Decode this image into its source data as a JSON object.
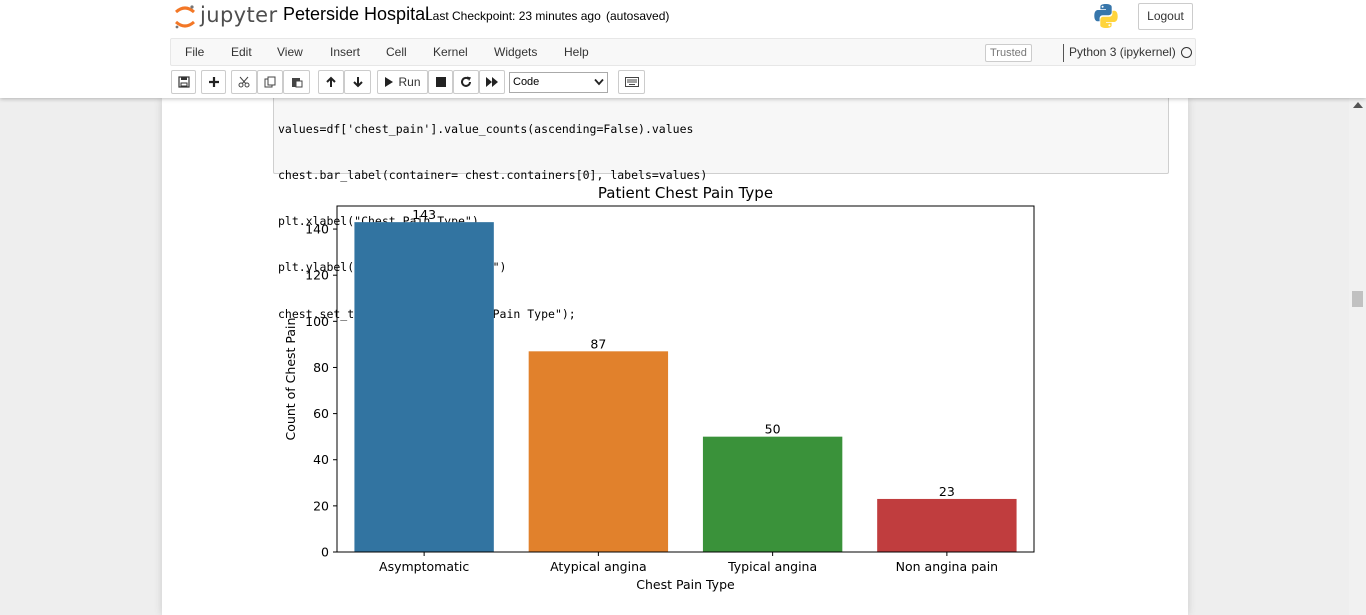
{
  "header": {
    "logo_text": "jupyter",
    "notebook_title": "Peterside Hospital",
    "checkpoint": "Last Checkpoint: 23 minutes ago",
    "autosave_status": "(autosaved)",
    "logout_label": "Logout"
  },
  "menu": {
    "items": [
      "File",
      "Edit",
      "View",
      "Insert",
      "Cell",
      "Kernel",
      "Widgets",
      "Help"
    ],
    "trusted_label": "Trusted",
    "kernel_name": "Python 3 (ipykernel)"
  },
  "toolbar": {
    "run_label": "Run",
    "cell_type": "Code"
  },
  "code_cell": {
    "lines": [
      "values=df['chest_pain'].value_counts(ascending=False).values",
      "chest.bar_label(container= chest.containers[0], labels=values)",
      "plt.xlabel(\"Chest Pain Type\")",
      "plt.ylabel(\"Count of Chest Pain\")",
      "chest.set_title(\"Patient Chest Pain Type\");"
    ]
  },
  "chart_data": {
    "type": "bar",
    "title": "Patient Chest Pain Type",
    "xlabel": "Chest Pain Type",
    "ylabel": "Count of Chest Pain",
    "categories": [
      "Asymptomatic",
      "Atypical angina",
      "Typical angina",
      "Non angina pain"
    ],
    "values": [
      143,
      87,
      50,
      23
    ],
    "data_labels": [
      "143",
      "87",
      "50",
      "23"
    ],
    "colors": [
      "#3274a1",
      "#e1812c",
      "#3a923a",
      "#c03d3e"
    ],
    "ylim": [
      0,
      150
    ],
    "yticks": [
      0,
      20,
      40,
      60,
      80,
      100,
      120,
      140
    ],
    "grid": false,
    "legend": "none"
  },
  "colors": {
    "logo_orange": "#f37726",
    "python_blue": "#3776ab",
    "python_yellow": "#ffd43b"
  }
}
